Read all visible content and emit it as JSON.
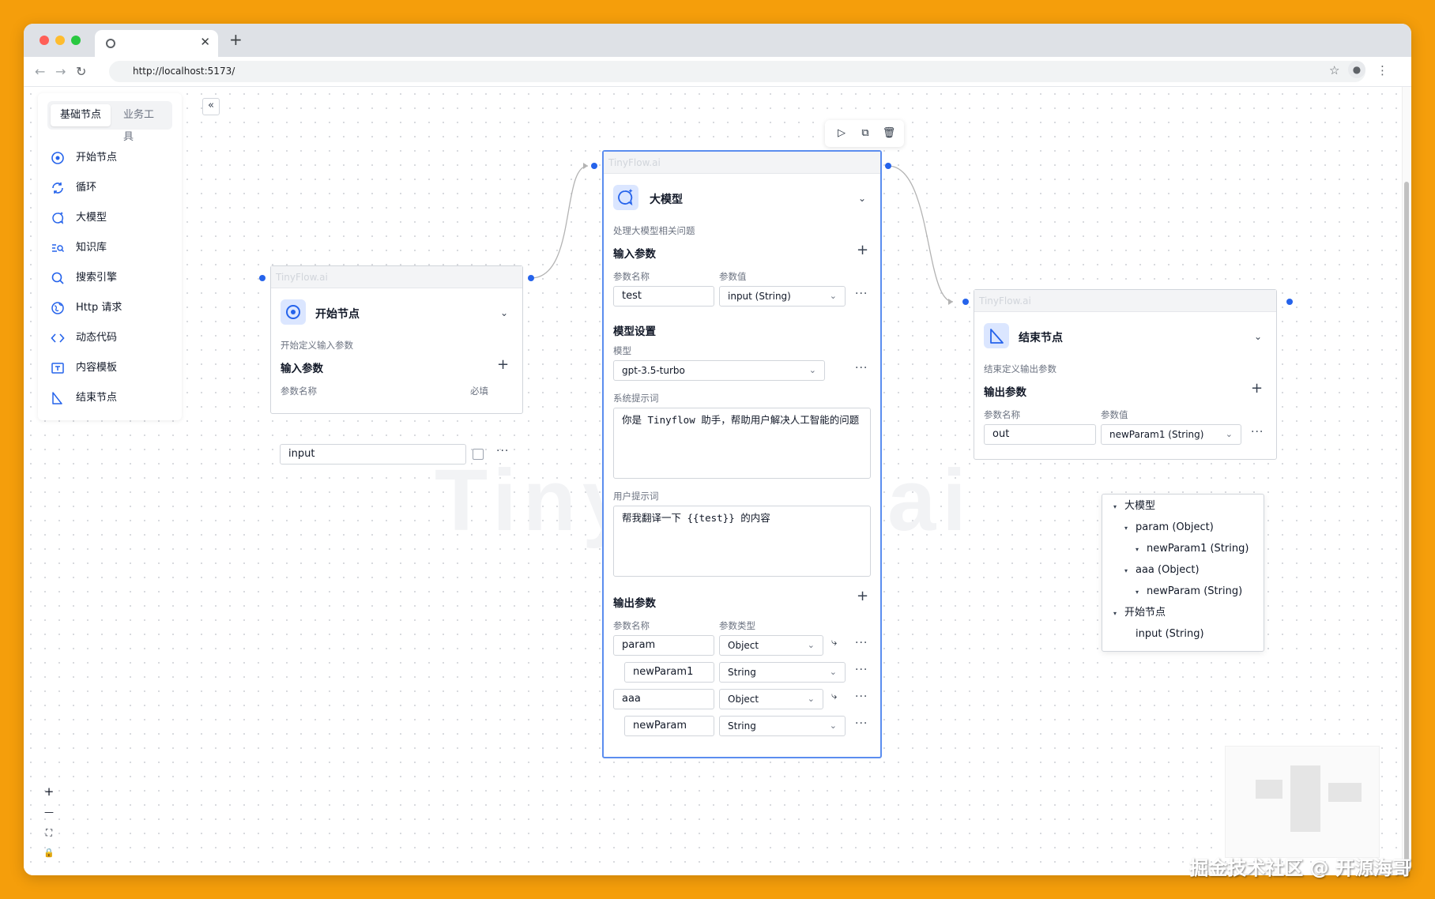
{
  "browser": {
    "url": "http://localhost:5173/",
    "close_glyph": "✕",
    "newtab_glyph": "+",
    "back_glyph": "←",
    "forward_glyph": "→",
    "reload_glyph": "↻",
    "star_glyph": "☆",
    "menu_glyph": "⋮"
  },
  "sidebar": {
    "tabs": [
      "基础节点",
      "业务工具"
    ],
    "items": [
      {
        "label": "开始节点",
        "icon": "start-icon"
      },
      {
        "label": "循环",
        "icon": "loop-icon"
      },
      {
        "label": "大模型",
        "icon": "llm-icon"
      },
      {
        "label": "知识库",
        "icon": "knowledge-icon"
      },
      {
        "label": "搜索引擎",
        "icon": "search-icon"
      },
      {
        "label": "Http 请求",
        "icon": "globe-icon"
      },
      {
        "label": "动态代码",
        "icon": "code-icon"
      },
      {
        "label": "内容模板",
        "icon": "template-icon"
      },
      {
        "label": "结束节点",
        "icon": "end-icon"
      }
    ],
    "collapse_glyph": "«"
  },
  "canvas": {
    "watermark": "TinyFlow.ai"
  },
  "toolbar": {
    "run_glyph": "▷",
    "copy_glyph": "⧉",
    "delete_glyph": "🗑"
  },
  "start_node": {
    "brand": "TinyFlow.ai",
    "title": "开始节点",
    "desc": "开始定义输入参数",
    "section": "输入参数",
    "col_name": "参数名称",
    "col_required": "必填",
    "param": "input"
  },
  "llm_node": {
    "brand": "TinyFlow.ai",
    "title": "大模型",
    "desc": "处理大模型相关问题",
    "input_section": "输入参数",
    "col_name": "参数名称",
    "col_value": "参数值",
    "input_param": "test",
    "input_value": "input (String)",
    "model_section": "模型设置",
    "model_label": "模型",
    "model_value": "gpt-3.5-turbo",
    "system_label": "系统提示词",
    "system_prompt": "你是 Tinyflow 助手，帮助用户解决人工智能的问题",
    "user_label": "用户提示词",
    "user_prompt": "帮我翻译一下 {{test}} 的内容",
    "output_section": "输出参数",
    "col_type": "参数类型",
    "outputs": [
      {
        "name": "param",
        "type": "Object"
      },
      {
        "name": "newParam1",
        "type": "String"
      },
      {
        "name": "aaa",
        "type": "Object"
      },
      {
        "name": "newParam",
        "type": "String"
      }
    ]
  },
  "end_node": {
    "brand": "TinyFlow.ai",
    "title": "结束节点",
    "desc": "结束定义输出参数",
    "section": "输出参数",
    "col_name": "参数名称",
    "col_value": "参数值",
    "param": "out",
    "value": "newParam1 (String)"
  },
  "tree": {
    "items": [
      "大模型",
      "param (Object)",
      "newParam1 (String)",
      "aaa (Object)",
      "newParam (String)",
      "开始节点",
      "input (String)"
    ]
  },
  "zoom": {
    "in": "+",
    "out": "—",
    "fit": "⛶",
    "lock": "🔒"
  },
  "footer": {
    "watermark": "掘金技术社区 @ 开源海哥"
  },
  "colors": {
    "accent": "#2563eb",
    "node_icon_bg": "#dbe6ff",
    "background": "#f59e0b"
  }
}
